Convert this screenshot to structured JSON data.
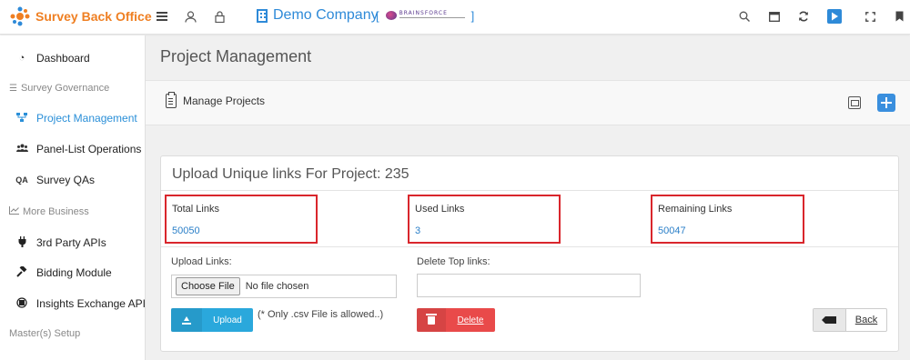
{
  "app": {
    "title": "Survey Back Office",
    "company": "Demo Company",
    "brand_text": "BRAINSFORCE",
    "colors": {
      "accent": "#2e8ad8",
      "brand": "#ef7f22",
      "danger": "#e94a4a",
      "info": "#2aa8dc",
      "highlight_border": "#d9262c"
    }
  },
  "topbar": {
    "icons": [
      "menu-icon",
      "user-icon",
      "lock-icon",
      "search-icon",
      "window-icon",
      "refresh-icon",
      "play-icon",
      "fullscreen-icon",
      "bookmark-icon"
    ]
  },
  "sidebar": {
    "items": [
      {
        "label": "Dashboard",
        "icon": "gauge-icon"
      },
      {
        "label": "Survey Governance",
        "icon": "list-icon",
        "type": "section"
      },
      {
        "label": "Project Management",
        "icon": "sitemap-icon",
        "active": true
      },
      {
        "label": "Panel-List Operations",
        "icon": "users-icon"
      },
      {
        "label": "Survey QAs",
        "icon": "qa-icon"
      },
      {
        "label": "More Business",
        "icon": "chart-icon",
        "type": "section"
      },
      {
        "label": "3rd Party APIs",
        "icon": "plug-icon"
      },
      {
        "label": "Bidding Module",
        "icon": "gavel-icon"
      },
      {
        "label": "Insights Exchange API",
        "icon": "exchange-icon"
      },
      {
        "label": "Master(s) Setup",
        "type": "section"
      }
    ]
  },
  "main": {
    "page_title": "Project Management",
    "toolbar": {
      "manage_label": "Manage Projects"
    },
    "card": {
      "title": "Upload Unique links For Project: 235",
      "stats": [
        {
          "label": "Total Links",
          "value": "50050"
        },
        {
          "label": "Used Links",
          "value": "3"
        },
        {
          "label": "Remaining Links",
          "value": "50047"
        }
      ],
      "upload_label": "Upload Links:",
      "choose_file": "Choose File",
      "no_file": "No file chosen",
      "delete_top_label": "Delete Top links:",
      "delete_input_value": "",
      "upload_button": "Upload",
      "upload_note": "(* Only .csv File is allowed..)",
      "delete_button": "Delete",
      "back_button": "Back"
    }
  }
}
